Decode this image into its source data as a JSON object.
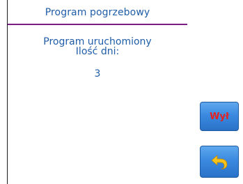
{
  "header": {
    "title": "Program pogrzebowy"
  },
  "message": {
    "line1": "Program uruchomiony",
    "line2": "Ilość dni:",
    "value": "3"
  },
  "buttons": {
    "off_label": "Wył",
    "back_icon": "back-arrow-icon"
  },
  "colors": {
    "text": "#1f5da8",
    "title_rule": "#7a1e86",
    "button": "#3a8ae0",
    "off_label": "#e8201e",
    "back_arrow": "#f7c21a"
  }
}
